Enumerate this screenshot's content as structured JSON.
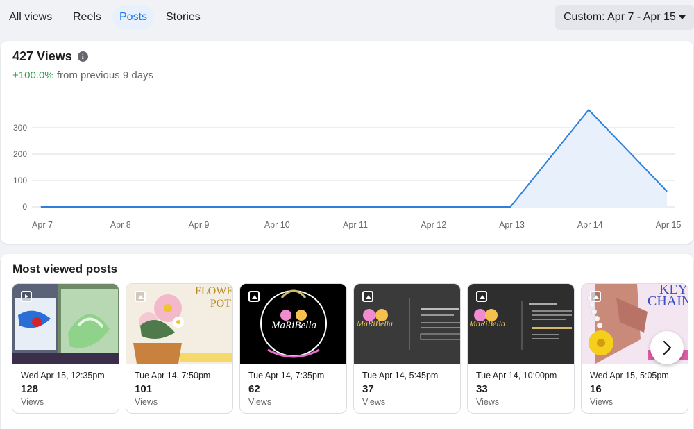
{
  "tabs": [
    {
      "label": "All views",
      "active": false
    },
    {
      "label": "Reels",
      "active": false
    },
    {
      "label": "Posts",
      "active": true
    },
    {
      "label": "Stories",
      "active": false
    }
  ],
  "date_range": "Custom: Apr 7 - Apr 15",
  "views": {
    "title": "427 Views",
    "change": "+100.0%",
    "change_suffix": "from previous 9 days"
  },
  "chart_data": {
    "type": "area",
    "categories": [
      "Apr 7",
      "Apr 8",
      "Apr 9",
      "Apr 10",
      "Apr 11",
      "Apr 12",
      "Apr 13",
      "Apr 14",
      "Apr 15"
    ],
    "values": [
      0,
      0,
      0,
      0,
      0,
      0,
      0,
      368,
      59
    ],
    "yticks": [
      0,
      100,
      200,
      300
    ],
    "ylim": [
      0,
      400
    ],
    "grid": true,
    "line_color": "#2d7fdb",
    "fill_color": "#e7f0fb"
  },
  "most_viewed": {
    "title": "Most viewed posts",
    "posts": [
      {
        "date": "Wed Apr 15, 12:35pm",
        "count": "128",
        "views_label": "Views",
        "type": "reel"
      },
      {
        "date": "Tue Apr 14, 7:50pm",
        "count": "101",
        "views_label": "Views",
        "type": "photo",
        "overlay_text": "FLOWER POT"
      },
      {
        "date": "Tue Apr 14, 7:35pm",
        "count": "62",
        "views_label": "Views",
        "type": "photo",
        "overlay_text": "MaRiBella"
      },
      {
        "date": "Tue Apr 14, 5:45pm",
        "count": "37",
        "views_label": "Views",
        "type": "photo",
        "overlay_text": "MaRiBella"
      },
      {
        "date": "Tue Apr 14, 10:00pm",
        "count": "33",
        "views_label": "Views",
        "type": "photo",
        "overlay_text": "MaRiBella"
      },
      {
        "date": "Wed Apr 15, 5:05pm",
        "count": "16",
        "views_label": "Views",
        "type": "photo",
        "overlay_text": "KEY CHAIN"
      }
    ]
  }
}
